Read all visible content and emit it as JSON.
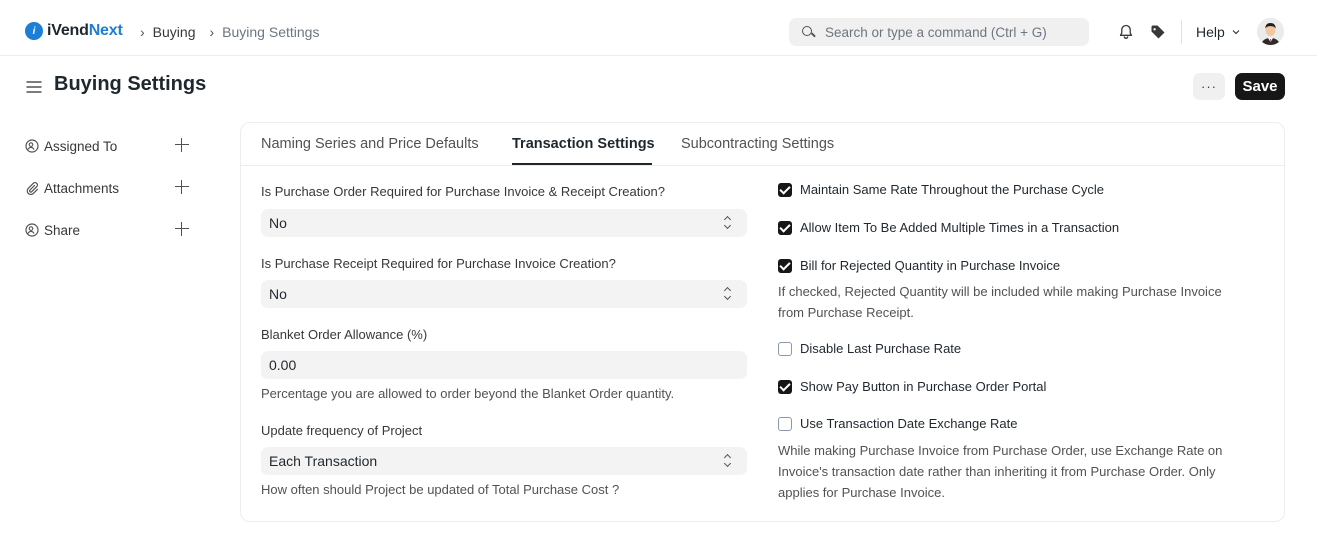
{
  "navbar": {
    "logo_mark": "i",
    "logo_prefix": "iVend",
    "logo_suffix": "Next",
    "breadcrumbs": [
      "Buying",
      "Buying Settings"
    ],
    "search_placeholder": "Search or type a command (Ctrl + G)",
    "help_label": "Help"
  },
  "page": {
    "title": "Buying Settings",
    "more_label": "···",
    "save_label": "Save"
  },
  "sidebar": {
    "items": [
      {
        "label": "Assigned To"
      },
      {
        "label": "Attachments"
      },
      {
        "label": "Share"
      }
    ]
  },
  "tabs": [
    {
      "label": "Naming Series and Price Defaults",
      "active": false
    },
    {
      "label": "Transaction Settings",
      "active": true
    },
    {
      "label": "Subcontracting Settings",
      "active": false
    }
  ],
  "left_fields": {
    "po_required": {
      "label": "Is Purchase Order Required for Purchase Invoice & Receipt Creation?",
      "value": "No"
    },
    "pr_required": {
      "label": "Is Purchase Receipt Required for Purchase Invoice Creation?",
      "value": "No"
    },
    "blanket": {
      "label": "Blanket Order Allowance (%)",
      "value": "0.00",
      "description": "Percentage you are allowed to order beyond the Blanket Order quantity."
    },
    "project_freq": {
      "label": "Update frequency of Project",
      "value": "Each Transaction",
      "description": "How often should Project be updated of Total Purchase Cost ?"
    }
  },
  "checkboxes": [
    {
      "label": "Maintain Same Rate Throughout the Purchase Cycle",
      "checked": true
    },
    {
      "label": "Allow Item To Be Added Multiple Times in a Transaction",
      "checked": true
    },
    {
      "label": "Bill for Rejected Quantity in Purchase Invoice",
      "checked": true,
      "description_lines": [
        "If checked, Rejected Quantity will be included while making Purchase Invoice",
        "from Purchase Receipt."
      ]
    },
    {
      "label": "Disable Last Purchase Rate",
      "checked": false
    },
    {
      "label": "Show Pay Button in Purchase Order Portal",
      "checked": true
    },
    {
      "label": "Use Transaction Date Exchange Rate",
      "checked": false,
      "description_lines": [
        "While making Purchase Invoice from Purchase Order, use Exchange Rate on",
        "Invoice's transaction date rather than inheriting it from Purchase Order. Only",
        "applies for Purchase Invoice."
      ]
    }
  ],
  "colors": {
    "accent": "#1c7ed6",
    "primary_button": "#171717",
    "field_bg": "#f3f3f3"
  }
}
